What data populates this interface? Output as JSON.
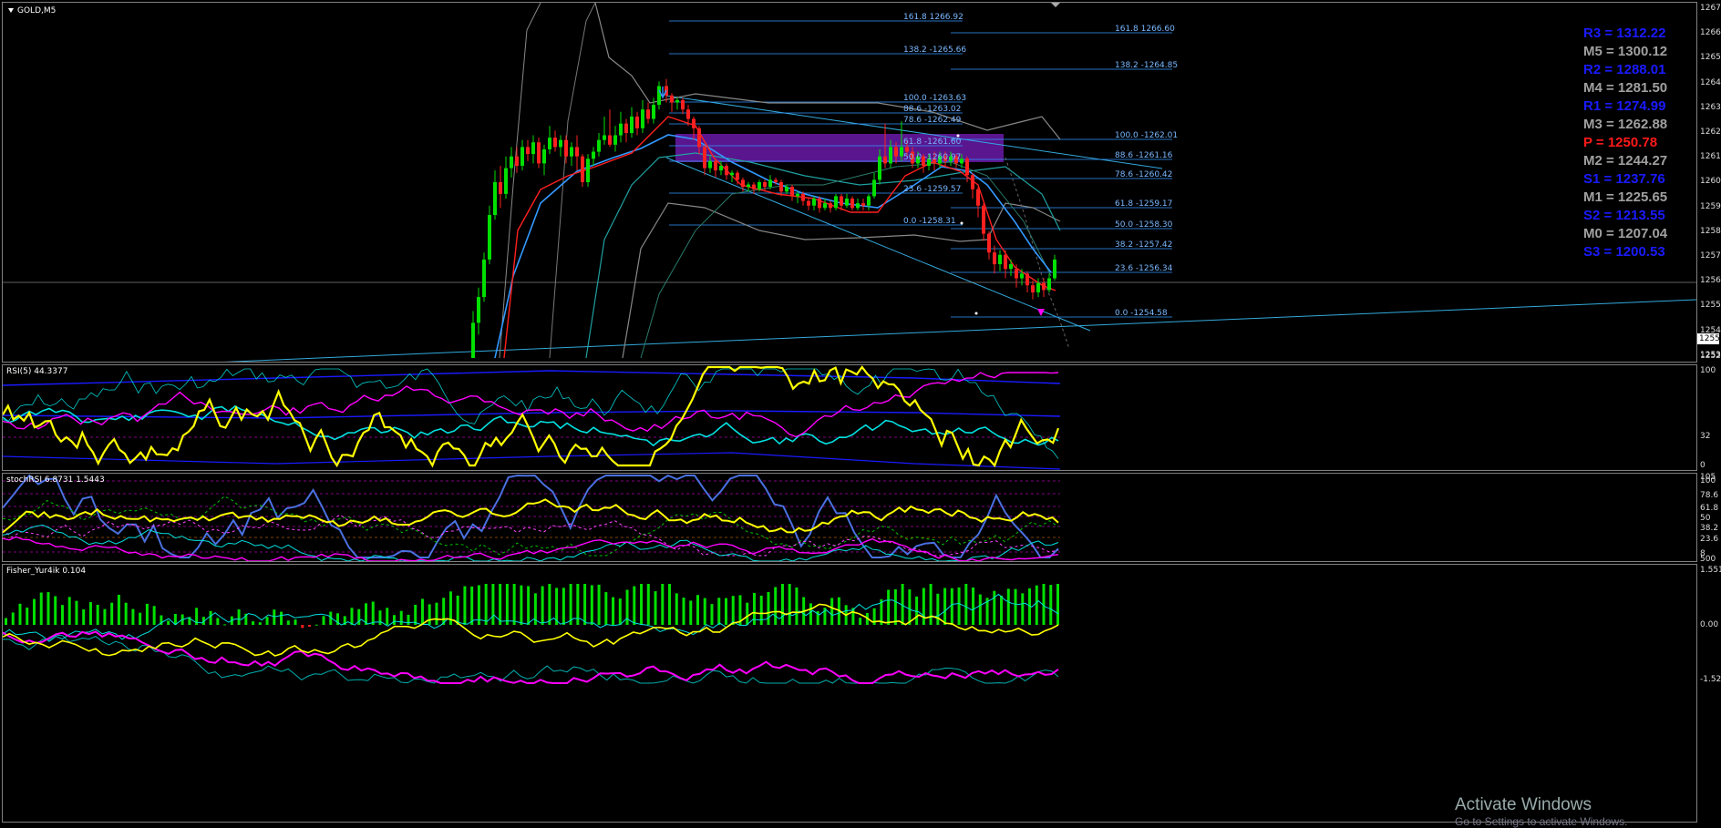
{
  "window": {
    "symbol_title": "GOLD,M5"
  },
  "main_price_axis": [
    "1267",
    "1266",
    "1265",
    "1264",
    "1263",
    "1262",
    "1261",
    "1260",
    "1259",
    "1258",
    "1257",
    "1256",
    "1255",
    "1254",
    "1253",
    "1252"
  ],
  "current_price_tag": "1255",
  "fib_left": [
    {
      "label": "161.8  1266.92"
    },
    {
      "label": "138.2  -1265.66"
    },
    {
      "label": "100.0 -1263.63"
    },
    {
      "label": "88.6 -1263.02"
    },
    {
      "label": "78.6 -1262.49"
    },
    {
      "label": "61.8 -1261.60"
    },
    {
      "label": "50.0 -1260.97"
    },
    {
      "label": "23.6 -1259.57"
    },
    {
      "label": "0.0 -1258.31"
    }
  ],
  "fib_right": [
    {
      "label": "161.8  1266.60"
    },
    {
      "label": "138.2  -1264.85"
    },
    {
      "label": "100.0 -1262.01"
    },
    {
      "label": "88.6 -1261.16"
    },
    {
      "label": "78.6 -1260.42"
    },
    {
      "label": "61.8 -1259.17"
    },
    {
      "label": "50.0 -1258.30"
    },
    {
      "label": "38.2 -1257.42"
    },
    {
      "label": "23.6 -1256.34"
    },
    {
      "label": "0.0 -1254.58"
    }
  ],
  "pivots": [
    {
      "label": "R3 = 1312.22",
      "color": "#1a1aff"
    },
    {
      "label": "M5 = 1300.12",
      "color": "#a0a0a0"
    },
    {
      "label": "R2 = 1288.01",
      "color": "#1a1aff"
    },
    {
      "label": "M4 = 1281.50",
      "color": "#a0a0a0"
    },
    {
      "label": "R1 = 1274.99",
      "color": "#1a1aff"
    },
    {
      "label": "M3 = 1262.88",
      "color": "#a0a0a0"
    },
    {
      "label": "P   = 1250.78",
      "color": "#ff1a1a"
    },
    {
      "label": "M2 = 1244.27",
      "color": "#a0a0a0"
    },
    {
      "label": "S1 = 1237.76",
      "color": "#1a1aff"
    },
    {
      "label": "M1 = 1225.65",
      "color": "#a0a0a0"
    },
    {
      "label": "S2 = 1213.55",
      "color": "#1a1aff"
    },
    {
      "label": "M0 = 1207.04",
      "color": "#a0a0a0"
    },
    {
      "label": "S3 = 1200.53",
      "color": "#1a1aff"
    }
  ],
  "rsi": {
    "title": "RSI(5) 44.3377",
    "axis": [
      "100",
      "32",
      "0"
    ]
  },
  "stochrsi": {
    "title": "stochRSI 6.8731 1.5443",
    "axis": [
      "105",
      "100",
      "78.6",
      "61.8",
      "50",
      "38.2",
      "23.6",
      "8",
      "500"
    ]
  },
  "fisher": {
    "title": "Fisher_Yur4ik 0.104",
    "axis": [
      "1.551",
      "0.00",
      "-1.52"
    ]
  },
  "watermark": {
    "line1": "Activate Windows",
    "line2": "Go to Settings to activate Windows."
  },
  "colors": {
    "bull": "#00e000",
    "bear": "#ff2020",
    "fib": "#3399ff",
    "zone": "#6a1aa8",
    "yellow": "#ffff00",
    "magenta": "#ff00ff",
    "cyan": "#00e0e0",
    "blue": "#2060ff"
  }
}
